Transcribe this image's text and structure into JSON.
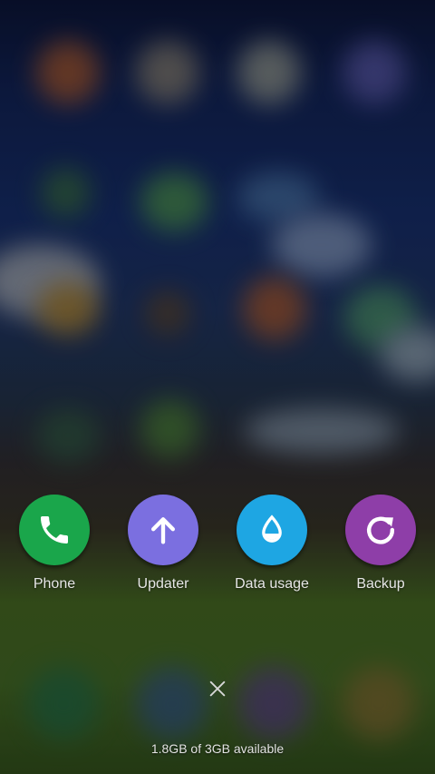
{
  "apps": [
    {
      "label": "Phone",
      "icon": "phone-icon",
      "color": "#1aa64b"
    },
    {
      "label": "Updater",
      "icon": "arrow-up-icon",
      "color": "#7b6fe0"
    },
    {
      "label": "Data usage",
      "icon": "water-drop-icon",
      "color": "#1ea6e3"
    },
    {
      "label": "Backup",
      "icon": "backup-icon",
      "color": "#8e3ea8"
    }
  ],
  "footer": {
    "close_icon": "close-icon",
    "memory_text": "1.8GB of 3GB available"
  }
}
